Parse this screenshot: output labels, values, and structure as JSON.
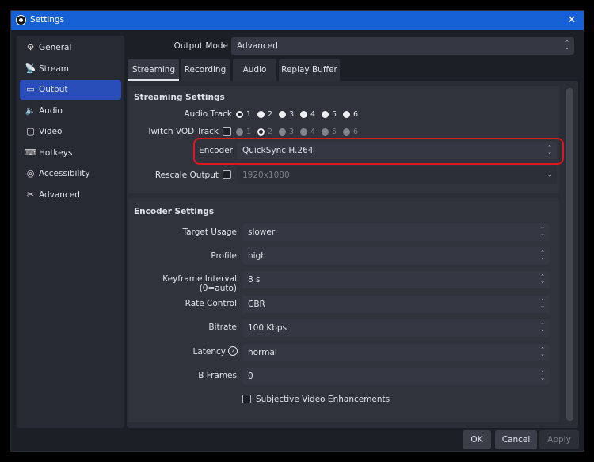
{
  "window": {
    "title": "Settings",
    "close_glyph": "✕"
  },
  "sidebar": {
    "items": [
      {
        "label": "General",
        "icon": "gear-icon",
        "glyph": "⚙",
        "active": false
      },
      {
        "label": "Stream",
        "icon": "antenna-icon",
        "glyph": "📡",
        "active": false
      },
      {
        "label": "Output",
        "icon": "monitor-icon",
        "glyph": "▭",
        "active": true
      },
      {
        "label": "Audio",
        "icon": "speaker-icon",
        "glyph": "🔈",
        "active": false
      },
      {
        "label": "Video",
        "icon": "screen-icon",
        "glyph": "▢",
        "active": false
      },
      {
        "label": "Hotkeys",
        "icon": "keyboard-icon",
        "glyph": "⌨",
        "active": false
      },
      {
        "label": "Accessibility",
        "icon": "accessibility-icon",
        "glyph": "◎",
        "active": false
      },
      {
        "label": "Advanced",
        "icon": "tools-icon",
        "glyph": "✂",
        "active": false
      }
    ]
  },
  "output_mode": {
    "label": "Output Mode",
    "value": "Advanced"
  },
  "tabs": [
    {
      "label": "Streaming",
      "active": true
    },
    {
      "label": "Recording",
      "active": false
    },
    {
      "label": "Audio",
      "active": false
    },
    {
      "label": "Replay Buffer",
      "active": false
    }
  ],
  "streaming_settings": {
    "title": "Streaming Settings",
    "audio_track": {
      "label": "Audio Track",
      "selected": 1,
      "tracks": [
        "1",
        "2",
        "3",
        "4",
        "5",
        "6"
      ]
    },
    "twitch_vod": {
      "label": "Twitch VOD Track",
      "checked": false,
      "selected": 2,
      "tracks": [
        "1",
        "2",
        "3",
        "4",
        "5",
        "6"
      ]
    },
    "encoder": {
      "label": "Encoder",
      "value": "QuickSync H.264"
    },
    "rescale": {
      "label": "Rescale Output",
      "checked": false,
      "value": "1920x1080"
    }
  },
  "encoder_settings": {
    "title": "Encoder Settings",
    "target_usage": {
      "label": "Target Usage",
      "value": "slower"
    },
    "profile": {
      "label": "Profile",
      "value": "high"
    },
    "keyframe": {
      "label": "Keyframe Interval (0=auto)",
      "value": "8 s"
    },
    "rate_control": {
      "label": "Rate Control",
      "value": "CBR"
    },
    "bitrate": {
      "label": "Bitrate",
      "value": "100 Kbps"
    },
    "latency": {
      "label": "Latency",
      "value": "normal",
      "help_glyph": "?"
    },
    "b_frames": {
      "label": "B Frames",
      "value": "0"
    },
    "subjective": {
      "label": "Subjective Video Enhancements",
      "checked": false
    }
  },
  "buttons": {
    "ok": "OK",
    "cancel": "Cancel",
    "apply": "Apply"
  },
  "colors": {
    "accent": "#284cb8",
    "titlebar": "#1560d4",
    "highlight": "#e0151d",
    "background": "#1d1f26"
  }
}
